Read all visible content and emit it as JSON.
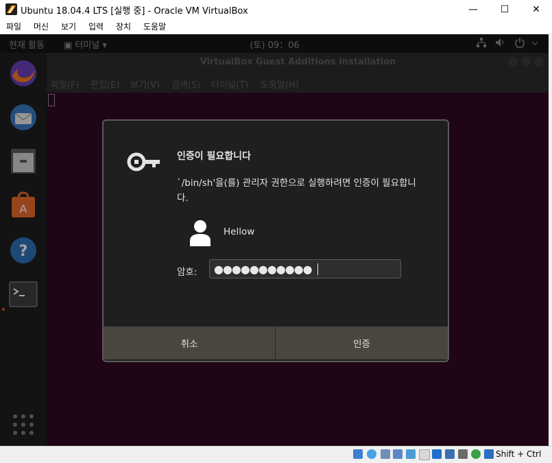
{
  "window": {
    "title": "Ubuntu 18.04.4 LTS [실행 중] - Oracle VM VirtualBox",
    "minimize": "—",
    "maximize": "☐",
    "close": "✕"
  },
  "menubar": {
    "items": [
      "파일",
      "머신",
      "보기",
      "입력",
      "장치",
      "도움말"
    ]
  },
  "ubuntu_topbar": {
    "activities": "현재 활동",
    "app_menu": "▣ 터미널 ▾",
    "clock": "(토) 09：06",
    "network_icon": "network-icon",
    "volume_icon": "volume-icon",
    "power_icon": "power-icon"
  },
  "dock": {
    "items": [
      "firefox-icon",
      "thunderbird-icon",
      "files-icon",
      "software-icon",
      "help-icon",
      "terminal-icon",
      "show-apps-icon"
    ]
  },
  "terminal": {
    "title": "VirtualBox Guest Additions installation",
    "menu": [
      "파일(F)",
      "편집(E)",
      "보기(V)",
      "검색(S)",
      "터미널(T)",
      "도움말(H)"
    ]
  },
  "auth_dialog": {
    "icon": "key-icon",
    "title": "인증이 필요합니다",
    "message": "`/bin/sh'을(를) 관리자 권한으로 실행하려면 인증이 필요합니다.",
    "user_icon": "user-icon",
    "user": "Hellow",
    "password_label": "암호:",
    "password_mask": "●●●●●●●●●●●",
    "cancel_label": "취소",
    "authenticate_label": "인증"
  },
  "statusbar": {
    "host_key": "Shift + Ctrl"
  },
  "colors": {
    "ubuntu_aubergine": "#2c001e",
    "dialog_bg": "#1f1f1f",
    "dialog_button": "#48463f",
    "accent_orange": "#e95420"
  }
}
